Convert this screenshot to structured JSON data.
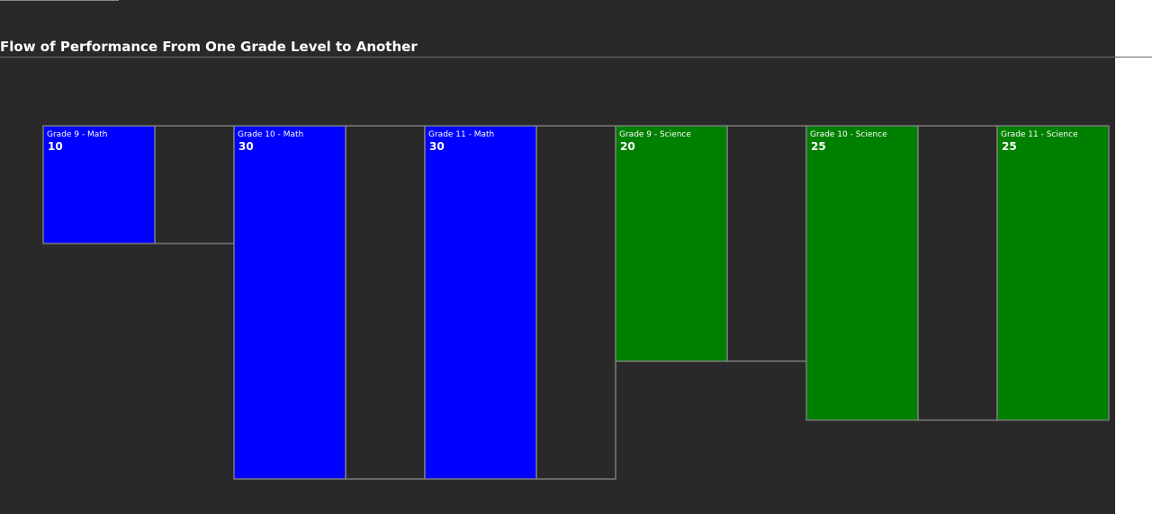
{
  "page": {
    "title": "Flow of Performance From One Grade Level to Another"
  },
  "colors": {
    "background": "#292929",
    "math": "#0000ff",
    "science": "#008000",
    "outline": "#7a7a7a",
    "text": "#ffffff"
  },
  "chart_data": {
    "type": "bar",
    "title": "Flow of Performance From One Grade Level to Another",
    "xlabel": "",
    "ylabel": "",
    "ylim": [
      0,
      30
    ],
    "grid": false,
    "legend": "none",
    "categories": [
      "Grade 9 - Math",
      "Grade 10 - Math",
      "Grade 11 - Math",
      "Grade 9 - Science",
      "Grade 10 - Science",
      "Grade 11 - Science"
    ],
    "values": [
      10,
      30,
      30,
      20,
      25,
      25
    ],
    "bar_colors": [
      "#0000ff",
      "#0000ff",
      "#0000ff",
      "#008000",
      "#008000",
      "#008000"
    ]
  }
}
